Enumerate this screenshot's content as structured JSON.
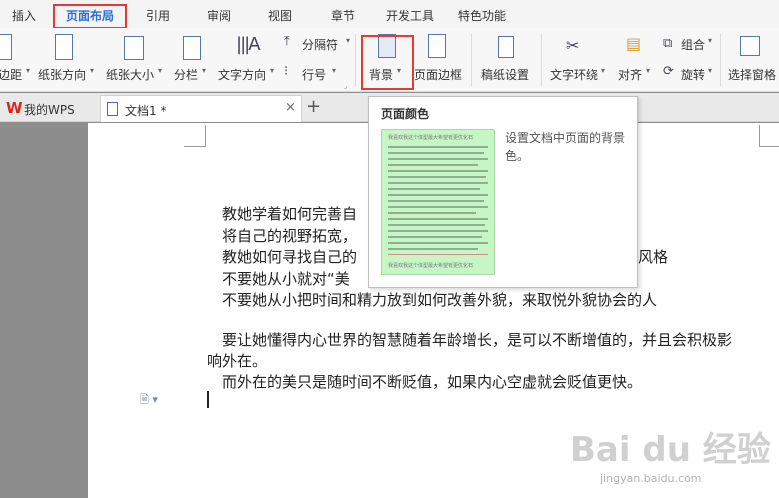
{
  "menu": {
    "tabs": [
      "插入",
      "页面布局",
      "引用",
      "审阅",
      "视图",
      "章节",
      "开发工具",
      "特色功能"
    ],
    "active": "页面布局"
  },
  "ribbon": {
    "margins": "边距",
    "orientation": "纸张方向",
    "size": "纸张大小",
    "columns": "分栏",
    "text_direction": "文字方向",
    "separator": "分隔符",
    "line_numbers": "行号",
    "background": "背景",
    "page_border": "页面边框",
    "grid_paper": "稿纸设置",
    "text_wrap": "文字环绕",
    "align": "对齐",
    "group": "组合",
    "rotate": "旋转",
    "selection_pane": "选择窗格"
  },
  "tabs": {
    "wps": "我的WPS",
    "doc": "文档1 *",
    "close": "×",
    "add": "+"
  },
  "document": {
    "lines": [
      "教她学着如何完善自",
      "将自己的视野拓宽，",
      "教她如何寻找自己的",
      "风格",
      "不要她从小就对“美",
      "不要她从小把时间和精力放到如何改善外貌，来取悦外貌协会的人",
      "要让她懂得内心世界的智慧随着年龄增长，是可以不断增值的，并且会积极影",
      "响外在。",
      "而外在的美只是随时间不断贬值，如果内心空虚就会贬值更快。"
    ]
  },
  "popup": {
    "title": "页面颜色",
    "description": "设置文档中页面的背景色。",
    "thumb_heading": "我喜欢我这个体型最大希望有更优化石",
    "thumb_color": "#c6f5c6"
  },
  "watermark": {
    "brand": "Bai du 经验",
    "url": "jingyan.baidu.com"
  },
  "colors": {
    "accent": "#2e6fd6",
    "highlight_box": "#e53935",
    "wps_red": "#d9261c"
  }
}
